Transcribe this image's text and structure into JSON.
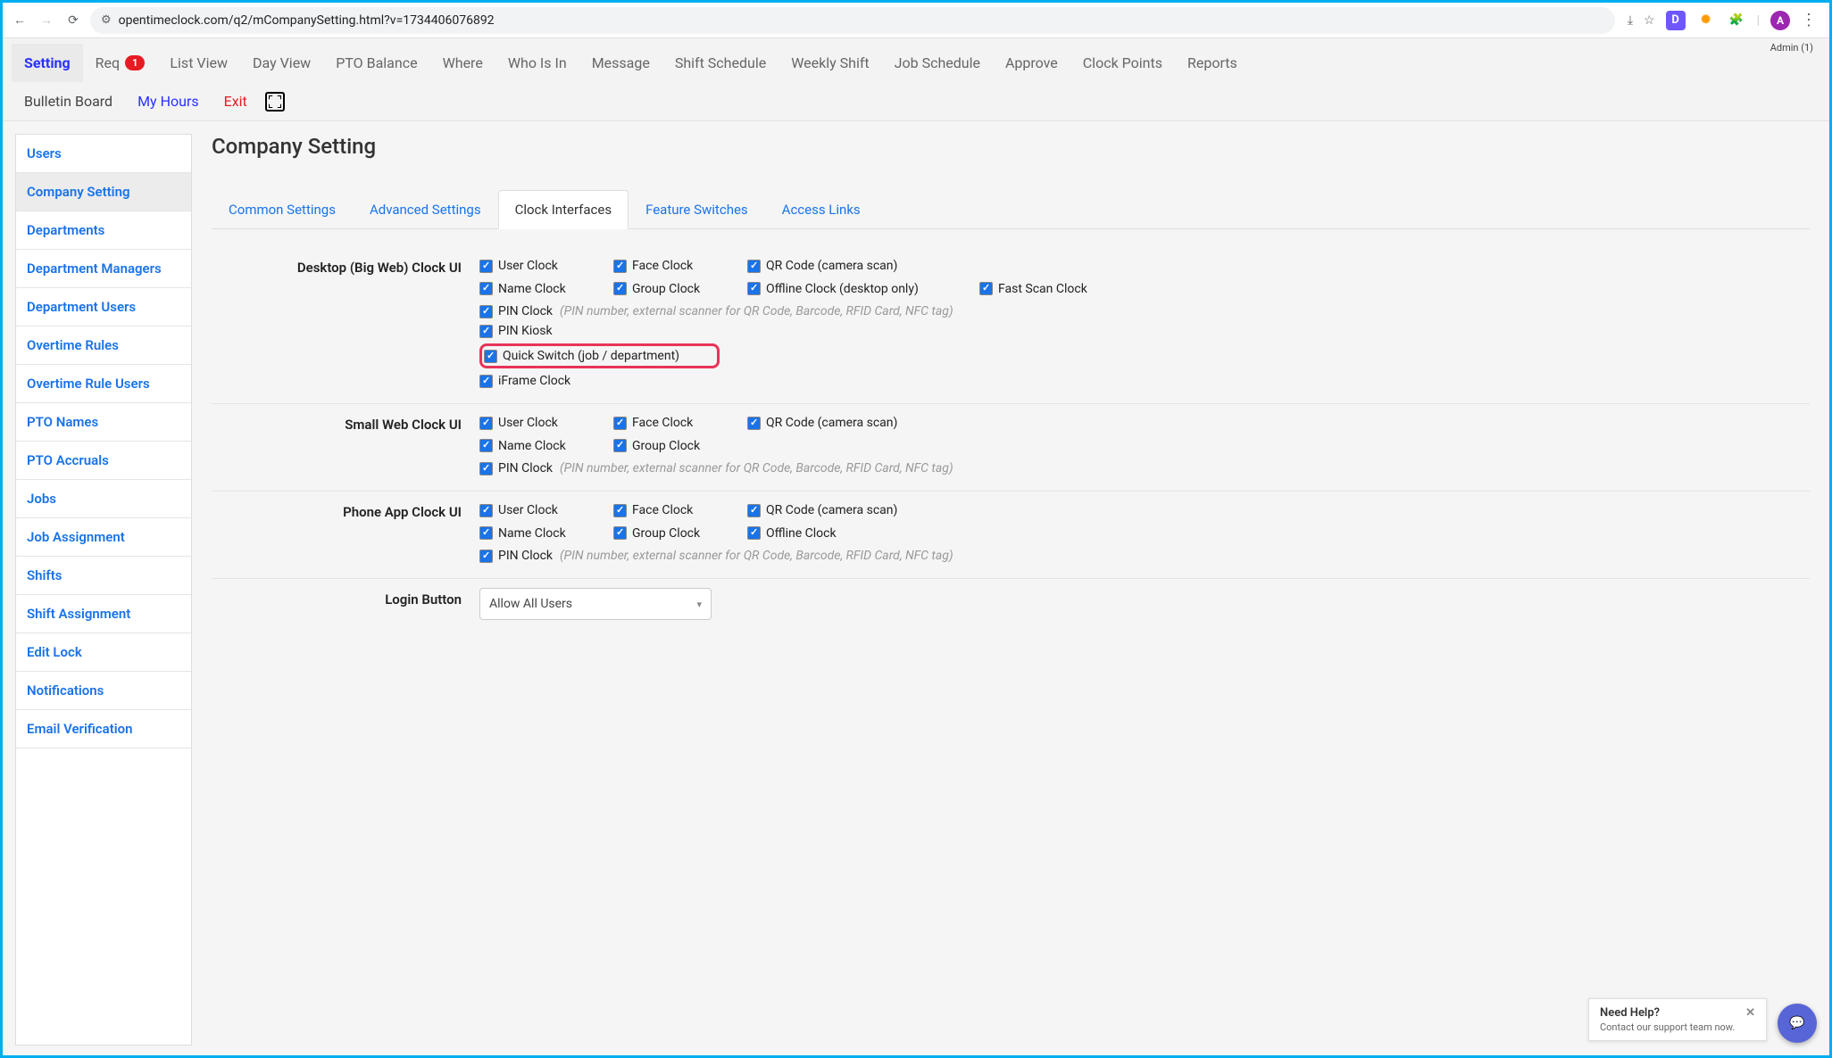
{
  "chrome": {
    "url": "opentimeclock.com/q2/mCompanySetting.html?v=1734406076892",
    "ext_d": "D",
    "avatar": "A"
  },
  "top_right": "Admin (1)",
  "topnav": {
    "setting": "Setting",
    "req": "Req",
    "req_badge": "1",
    "list_view": "List View",
    "day_view": "Day View",
    "pto_balance": "PTO Balance",
    "where": "Where",
    "who_is_in": "Who Is In",
    "message": "Message",
    "shift_schedule": "Shift Schedule",
    "weekly_shift": "Weekly Shift",
    "job_schedule": "Job Schedule",
    "approve": "Approve",
    "clock_points": "Clock Points",
    "reports": "Reports",
    "bulletin": "Bulletin Board",
    "my_hours": "My Hours",
    "exit": "Exit"
  },
  "sidebar": {
    "items": [
      "Users",
      "Company Setting",
      "Departments",
      "Department Managers",
      "Department Users",
      "Overtime Rules",
      "Overtime Rule Users",
      "PTO Names",
      "PTO Accruals",
      "Jobs",
      "Job Assignment",
      "Shifts",
      "Shift Assignment",
      "Edit Lock",
      "Notifications",
      "Email Verification"
    ]
  },
  "page_title": "Company Setting",
  "tabs": {
    "common": "Common Settings",
    "advanced": "Advanced Settings",
    "clock": "Clock Interfaces",
    "feature": "Feature Switches",
    "access": "Access Links"
  },
  "sections": {
    "desktop": {
      "label": "Desktop (Big Web) Clock UI",
      "user_clock": "User Clock",
      "face_clock": "Face Clock",
      "qr_code": "QR Code (camera scan)",
      "name_clock": "Name Clock",
      "group_clock": "Group Clock",
      "offline_clock": "Offline Clock (desktop only)",
      "fast_scan": "Fast Scan Clock",
      "pin_clock": "PIN Clock",
      "pin_hint": "(PIN number, external scanner for QR Code, Barcode, RFID Card, NFC tag)",
      "pin_kiosk": "PIN Kiosk",
      "quick_switch": "Quick Switch (job / department)",
      "iframe": "iFrame Clock"
    },
    "small": {
      "label": "Small Web Clock UI",
      "user_clock": "User Clock",
      "face_clock": "Face Clock",
      "qr_code": "QR Code (camera scan)",
      "name_clock": "Name Clock",
      "group_clock": "Group Clock",
      "pin_clock": "PIN Clock",
      "pin_hint": "(PIN number, external scanner for QR Code, Barcode, RFID Card, NFC tag)"
    },
    "phone": {
      "label": "Phone App Clock UI",
      "user_clock": "User Clock",
      "face_clock": "Face Clock",
      "qr_code": "QR Code (camera scan)",
      "name_clock": "Name Clock",
      "group_clock": "Group Clock",
      "offline_clock": "Offline Clock",
      "pin_clock": "PIN Clock",
      "pin_hint": "(PIN number, external scanner for QR Code, Barcode, RFID Card, NFC tag)"
    },
    "login": {
      "label": "Login Button",
      "selected": "Allow All Users"
    }
  },
  "help": {
    "title": "Need Help?",
    "sub": "Contact our support team now."
  }
}
